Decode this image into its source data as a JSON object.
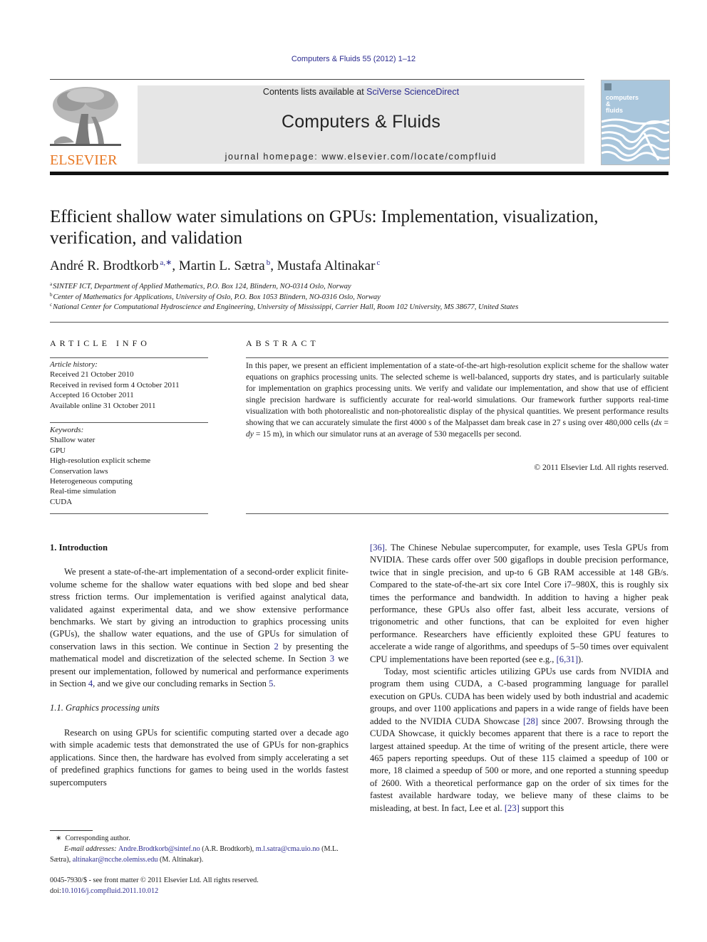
{
  "running_head": "Computers & Fluids 55 (2012) 1–12",
  "publisher": {
    "logo_icon": "elsevier-tree-icon",
    "wordmark": "ELSEVIER",
    "brand_color": "#e87722"
  },
  "journal_band": {
    "contents_prefix": "Contents lists available at ",
    "contents_link": "SciVerse ScienceDirect",
    "journal_name": "Computers & Fluids",
    "homepage": "journal homepage: www.elsevier.com/locate/compfluid"
  },
  "cover": {
    "icon": "journal-cover-image",
    "line1": "computers",
    "line2": "&",
    "line3": "fluids",
    "color": "#a9c6dc"
  },
  "article": {
    "title": "Efficient shallow water simulations on GPUs: Implementation, visualization, verification, and validation",
    "authors": [
      {
        "name": "André R. Brodtkorb",
        "sup": "a,∗"
      },
      {
        "name": "Martin L. Sætra",
        "sup": "b"
      },
      {
        "name": "Mustafa Altinakar",
        "sup": "c"
      }
    ],
    "affiliations": [
      {
        "key": "a",
        "text": "SINTEF ICT, Department of Applied Mathematics, P.O. Box 124, Blindern, NO-0314 Oslo, Norway"
      },
      {
        "key": "b",
        "text": "Center of Mathematics for Applications, University of Oslo, P.O. Box 1053 Blindern, NO-0316 Oslo, Norway"
      },
      {
        "key": "c",
        "text": "National Center for Computational Hydroscience and Engineering, University of Mississippi, Carrier Hall, Room 102 University, MS 38677, United States"
      }
    ]
  },
  "article_info": {
    "heading": "ARTICLE INFO",
    "history_label": "Article history:",
    "history": [
      "Received 21 October 2010",
      "Received in revised form 4 October 2011",
      "Accepted 16 October 2011",
      "Available online 31 October 2011"
    ],
    "keywords_label": "Keywords:",
    "keywords": [
      "Shallow water",
      "GPU",
      "High-resolution explicit scheme",
      "Conservation laws",
      "Heterogeneous computing",
      "Real-time simulation",
      "CUDA"
    ]
  },
  "abstract": {
    "heading": "ABSTRACT",
    "text_part1": "In this paper, we present an efficient implementation of a state-of-the-art high-resolution explicit scheme for the shallow water equations on graphics processing units. The selected scheme is well-balanced, supports dry states, and is particularly suitable for implementation on graphics processing units. We verify and validate our implementation, and show that use of efficient single precision hardware is sufficiently accurate for real-world simulations. Our framework further supports real-time visualization with both photorealistic and non-photorealistic display of the physical quantities. We present performance results showing that we can accurately simulate the first 4000 s of the Malpasset dam break case in 27 s using over 480,000 cells (",
    "math_dx": "dx",
    "math_eq1": " = ",
    "math_dy": "dy",
    "math_eq2": " = 15 m",
    "text_part2": "), in which our simulator runs at an average of 530 megacells per second.",
    "copyright": "© 2011 Elsevier Ltd. All rights reserved."
  },
  "body": {
    "section1_heading": "1. Introduction",
    "intro_p1_a": "We present a state-of-the-art implementation of a second-order explicit finite-volume scheme for the shallow water equations with bed slope and bed shear stress friction terms. Our implementation is verified against analytical data, validated against experimental data, and we show extensive performance benchmarks. We start by giving an introduction to graphics processing units (GPUs), the shallow water equations, and the use of GPUs for simulation of conservation laws in this section. We continue in Section ",
    "ref_sec2": "2",
    "intro_p1_b": " by presenting the mathematical model and discretization of the selected scheme. In Section ",
    "ref_sec3": "3",
    "intro_p1_c": " we present our implementation, followed by numerical and performance experiments in Section ",
    "ref_sec4": "4",
    "intro_p1_d": ", and we give our concluding remarks in Section ",
    "ref_sec5": "5",
    "intro_p1_e": ".",
    "subsection_heading": "1.1. Graphics processing units",
    "gpu_p1_a": "Research on using GPUs for scientific computing started over a decade ago with simple academic tests that demonstrated the use of GPUs for non-graphics applications. Since then, the hardware has evolved from simply accelerating a set of predefined graphics functions for games to being used in the worlds fastest supercomputers ",
    "ref_36": "[36]",
    "gpu_p1_b": ". The Chinese Nebulae supercomputer, for example, uses Tesla GPUs from NVIDIA. These cards offer over 500 gigaflops in double precision performance, twice that in single precision, and up-to 6 GB RAM accessible at 148 GB/s. Compared to the state-of-the-art six core Intel Core i7–980X, this is roughly six times the performance and bandwidth. In addition to having a higher peak performance, these GPUs also offer fast, albeit less accurate, versions of trigonometric and other functions, that can be exploited for even higher performance. Researchers have efficiently exploited these GPU features to accelerate a wide range of algorithms, and speedups of 5–50 times over equivalent CPU implementations have been reported (see e.g., ",
    "ref_6_31": "[6,31]",
    "gpu_p1_c": ").",
    "gpu_p2_a": "Today, most scientific articles utilizing GPUs use cards from NVIDIA and program them using CUDA, a C-based programming language for parallel execution on GPUs. CUDA has been widely used by both industrial and academic groups, and over 1100 applications and papers in a wide range of fields have been added to the NVIDIA CUDA Showcase ",
    "ref_28": "[28]",
    "gpu_p2_b": " since 2007. Browsing through the CUDA Showcase, it quickly becomes apparent that there is a race to report the largest attained speedup. At the time of writing of the present article, there were 465 papers reporting speedups. Out of these 115 claimed a speedup of 100 or more, 18 claimed a speedup of 500 or more, and one reported a stunning speedup of 2600. With a theoretical performance gap on the order of six times for the fastest available hardware today, we believe many of these claims to be misleading, at best. In fact, Lee et al. ",
    "ref_23": "[23]",
    "gpu_p2_c": " support this"
  },
  "footnotes": {
    "corresponding_mark": "∗",
    "corresponding": "Corresponding author.",
    "email_label": "E-mail addresses: ",
    "email1": "Andre.Brodtkorb@sintef.no",
    "email1_name": " (A.R. Brodtkorb), ",
    "email2": "m.l.satra@cma.uio.no",
    "email2_name": " (M.L. Sætra), ",
    "email3": "altinakar@ncche.olemiss.edu",
    "email3_name": " (M. Altinakar)."
  },
  "front_matter": {
    "issn_line": "0045-7930/$ - see front matter © 2011 Elsevier Ltd. All rights reserved.",
    "doi_prefix": "doi:",
    "doi": "10.1016/j.compfluid.2011.10.012"
  },
  "link_color": "#2b2b8f"
}
